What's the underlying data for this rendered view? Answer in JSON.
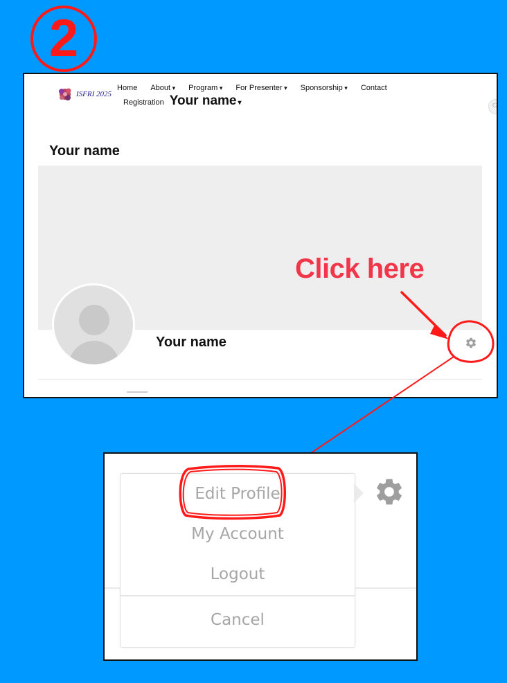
{
  "step_number": "2",
  "header": {
    "logo_text": "ISFRI 2025",
    "nav_items": [
      {
        "label": "Home",
        "dropdown": false
      },
      {
        "label": "About",
        "dropdown": true
      },
      {
        "label": "Program",
        "dropdown": true
      },
      {
        "label": "For Presenter",
        "dropdown": true
      },
      {
        "label": "Sponsorship",
        "dropdown": true
      },
      {
        "label": "Contact",
        "dropdown": false
      }
    ],
    "registration_label": "Registration",
    "user_menu_label": "Your name"
  },
  "profile": {
    "page_title": "Your name",
    "display_name": "Your name"
  },
  "annotation": {
    "callout": "Click here",
    "color": "#f2364a",
    "circle_color": "#ff1a1a"
  },
  "dropdown_menu": {
    "items": [
      "Edit Profile",
      "My Account",
      "Logout"
    ],
    "cancel_label": "Cancel",
    "highlighted": "Edit Profile"
  },
  "colors": {
    "background": "#0099ff",
    "gear": "#9e9e9e",
    "menu_text": "#a6a6a6"
  }
}
